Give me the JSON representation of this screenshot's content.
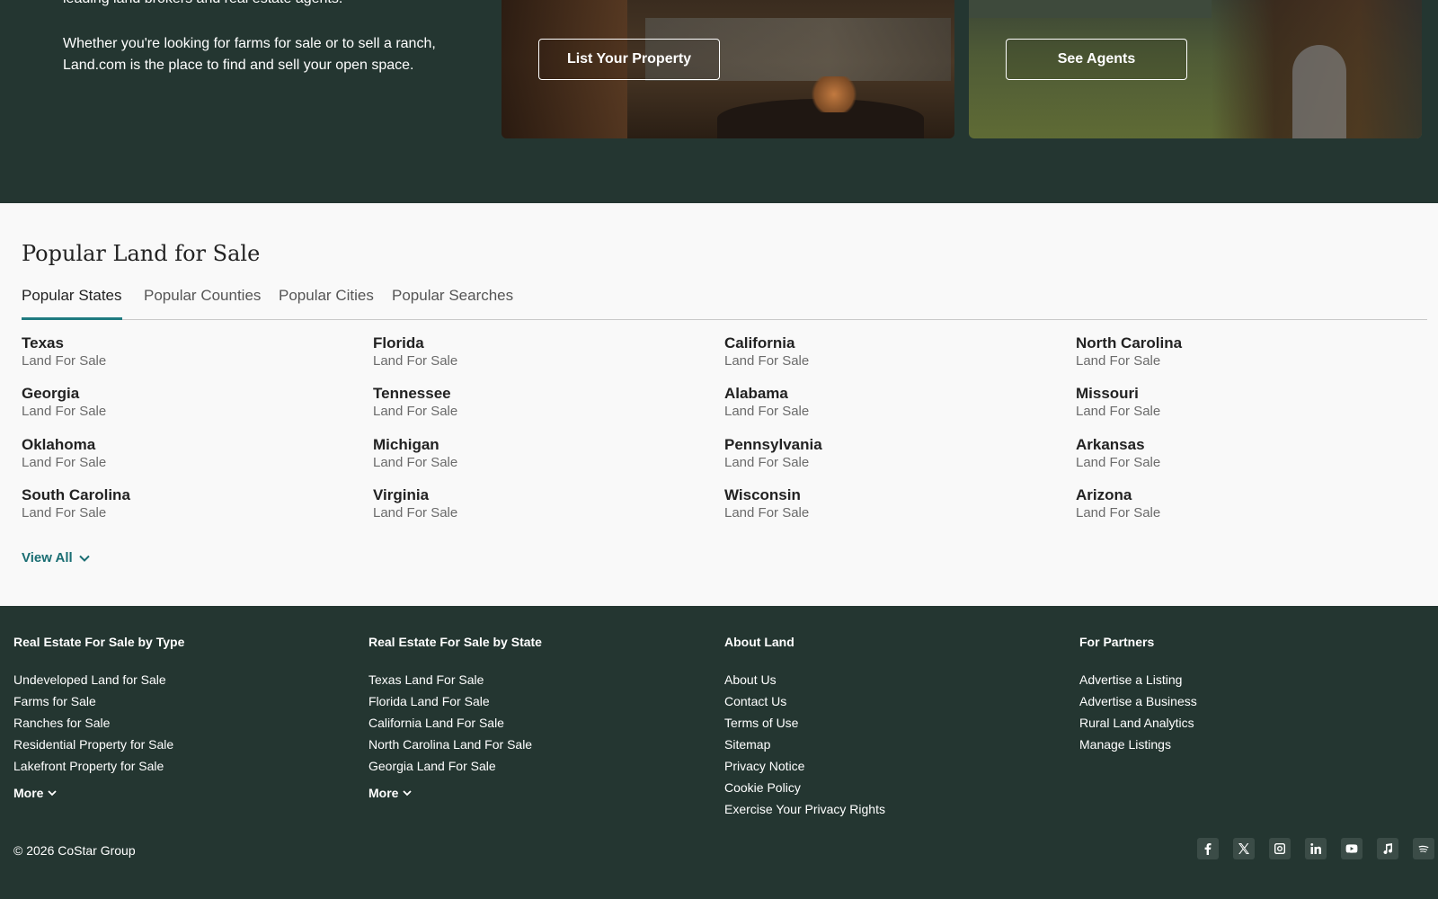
{
  "hero": {
    "line1": "leading land brokers and real estate agents.",
    "para2": "Whether you're looking for farms for sale or to sell a ranch, Land.com is the place to find and sell your open space.",
    "cards": [
      {
        "button": "List Your Property"
      },
      {
        "button": "See Agents"
      }
    ]
  },
  "popular": {
    "title": "Popular Land for Sale",
    "tabs": [
      "Popular States",
      "Popular Counties",
      "Popular Cities",
      "Popular Searches"
    ],
    "active_tab": "Popular States",
    "sub_label": "Land For Sale",
    "states": [
      "Texas",
      "Florida",
      "California",
      "North Carolina",
      "Georgia",
      "Tennessee",
      "Alabama",
      "Missouri",
      "Oklahoma",
      "Michigan",
      "Pennsylvania",
      "Arkansas",
      "South Carolina",
      "Virginia",
      "Wisconsin",
      "Arizona"
    ],
    "view_all": "View All"
  },
  "footer": {
    "columns": [
      {
        "heading": "Real Estate For Sale by Type",
        "links": [
          "Undeveloped Land for Sale",
          "Farms for Sale",
          "Ranches for Sale",
          "Residential Property for Sale",
          "Lakefront Property for Sale"
        ],
        "more": "More"
      },
      {
        "heading": "Real Estate For Sale by State",
        "links": [
          "Texas Land For Sale",
          "Florida Land For Sale",
          "California Land For Sale",
          "North Carolina Land For Sale",
          "Georgia Land For Sale"
        ],
        "more": "More"
      },
      {
        "heading": "About Land",
        "links": [
          "About Us",
          "Contact Us",
          "Terms of Use",
          "Sitemap",
          "Privacy Notice",
          "Cookie Policy",
          "Exercise Your Privacy Rights"
        ]
      },
      {
        "heading": "For Partners",
        "links": [
          "Advertise a Listing",
          "Advertise a Business",
          "Rural Land Analytics",
          "Manage Listings"
        ]
      }
    ],
    "copyright": "© 2026 CoStar Group",
    "socials": [
      "facebook-icon",
      "x-icon",
      "instagram-icon",
      "linkedin-icon",
      "youtube-icon",
      "music-icon",
      "spotify-icon"
    ]
  },
  "colors": {
    "dark_green": "#243631",
    "accent_teal": "#1f7a80",
    "link_teal": "#1a6e73"
  }
}
